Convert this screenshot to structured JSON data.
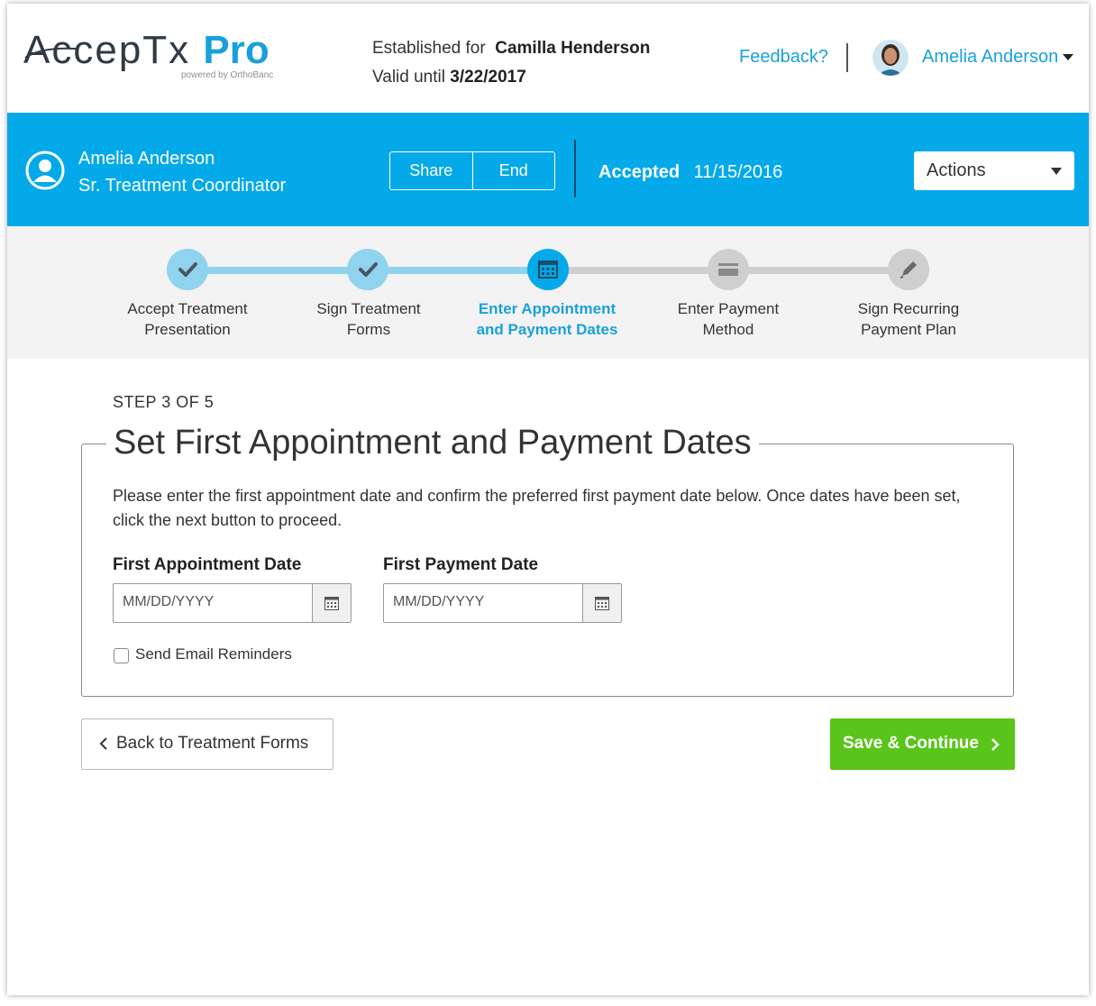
{
  "header": {
    "logo_text": "AccepTx",
    "logo_pro": "Pro",
    "logo_sub": "powered by OrthoBanc",
    "established_prefix": "Established for",
    "patient_name": "Camilla Henderson",
    "valid_prefix": "Valid until",
    "valid_date": "3/22/2017",
    "feedback": "Feedback?",
    "user_name": "Amelia Anderson"
  },
  "bar": {
    "coordinator_name": "Amelia Anderson",
    "coordinator_title": "Sr. Treatment Coordinator",
    "share": "Share",
    "end": "End",
    "status": "Accepted",
    "status_date": "11/15/2016",
    "actions": "Actions"
  },
  "steps": [
    {
      "line1": "Accept Treatment",
      "line2": "Presentation",
      "state": "done"
    },
    {
      "line1": "Sign Treatment",
      "line2": "Forms",
      "state": "done"
    },
    {
      "line1": "Enter Appointment",
      "line2": "and Payment Dates",
      "state": "active"
    },
    {
      "line1": "Enter Payment",
      "line2": "Method",
      "state": "pending"
    },
    {
      "line1": "Sign Recurring",
      "line2": "Payment Plan",
      "state": "pending"
    }
  ],
  "main": {
    "step_count": "STEP 3 OF 5",
    "title": "Set First Appointment and Payment Dates",
    "description": "Please enter the first appointment date and confirm the preferred first payment date below. Once dates have been set, click the next button to proceed.",
    "appt_label": "First Appointment Date",
    "appt_placeholder": "MM/DD/YYYY",
    "pay_label": "First Payment Date",
    "pay_placeholder": "MM/DD/YYYY",
    "reminder_label": "Send Email Reminders",
    "back_button": "Back to Treatment Forms",
    "save_button": "Save & Continue"
  },
  "colors": {
    "brand_blue": "#03a9e8",
    "link_blue": "#1aa0dc",
    "done_circle": "#8fd3ef",
    "pending_circle": "#cfcfcf",
    "save_green": "#59c51b"
  }
}
